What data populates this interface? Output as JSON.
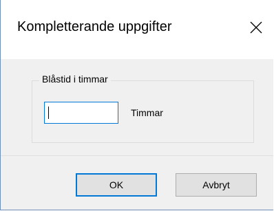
{
  "dialog": {
    "title": "Kompletterande uppgifter",
    "close_icon": "close-icon"
  },
  "group": {
    "legend": "Blåstid i timmar",
    "input_value": "",
    "unit_label": "Timmar"
  },
  "buttons": {
    "ok_label": "OK",
    "cancel_label": "Avbryt"
  },
  "colors": {
    "focus_accent": "#0078d7",
    "dialog_background": "#f0f0f0",
    "window_border": "#6f8fb8"
  }
}
